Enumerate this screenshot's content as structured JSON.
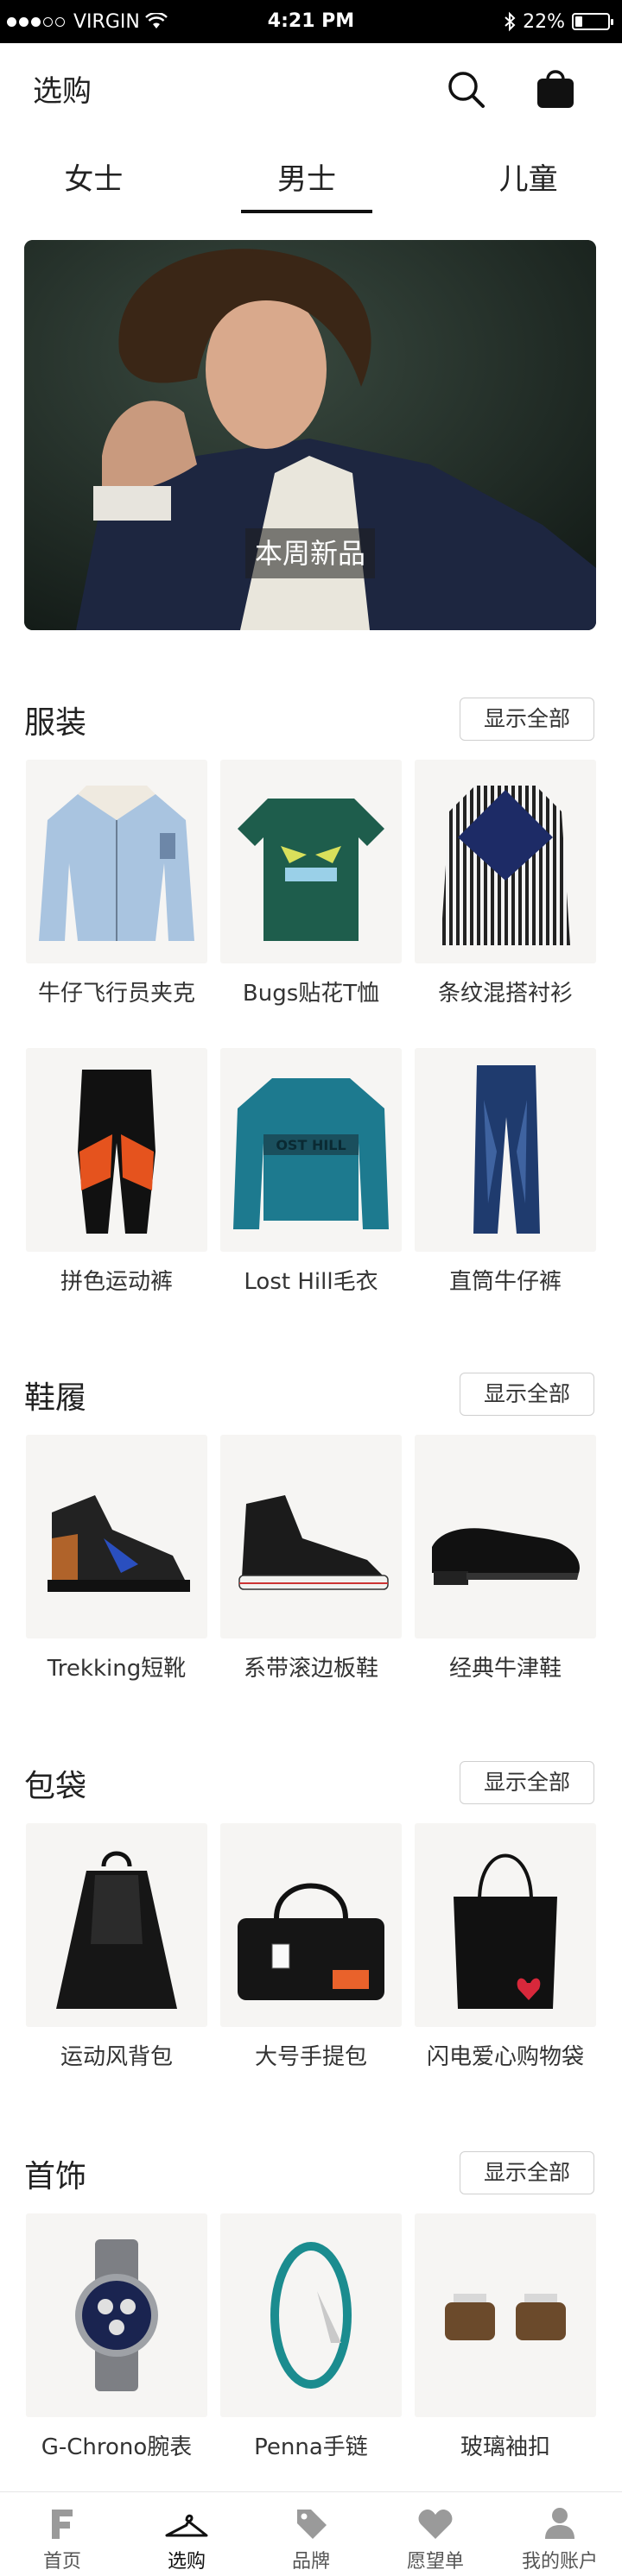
{
  "status_bar": {
    "carrier": "VIRGIN",
    "time": "4:21 PM",
    "battery": "22%",
    "battery_level": 0.22
  },
  "header": {
    "title": "选购",
    "search_icon": "search-icon",
    "bag_icon": "shopping-bag-icon"
  },
  "tabs": [
    {
      "label": "女士",
      "active": false
    },
    {
      "label": "男士",
      "active": true
    },
    {
      "label": "儿童",
      "active": false
    }
  ],
  "hero": {
    "label": "本周新品"
  },
  "sections": [
    {
      "title": "服装",
      "show_all": "显示全部",
      "products": [
        {
          "name": "牛仔飞行员夹克"
        },
        {
          "name": "Bugs贴花T恤"
        },
        {
          "name": "条纹混搭衬衫"
        },
        {
          "name": "拼色运动裤"
        },
        {
          "name": "Lost Hill毛衣"
        },
        {
          "name": "直筒牛仔裤"
        }
      ]
    },
    {
      "title": "鞋履",
      "show_all": "显示全部",
      "products": [
        {
          "name": "Trekking短靴"
        },
        {
          "name": "系带滚边板鞋"
        },
        {
          "name": "经典牛津鞋"
        }
      ]
    },
    {
      "title": "包袋",
      "show_all": "显示全部",
      "products": [
        {
          "name": "运动风背包"
        },
        {
          "name": "大号手提包"
        },
        {
          "name": "闪电爱心购物袋"
        }
      ]
    },
    {
      "title": "首饰",
      "show_all": "显示全部",
      "products": [
        {
          "name": "G-Chrono腕表"
        },
        {
          "name": "Penna手链"
        },
        {
          "name": "玻璃袖扣"
        }
      ]
    }
  ],
  "bottom_nav": [
    {
      "label": "首页",
      "icon": "home-f-icon",
      "active": false
    },
    {
      "label": "选购",
      "icon": "hanger-icon",
      "active": true
    },
    {
      "label": "品牌",
      "icon": "tag-icon",
      "active": false
    },
    {
      "label": "愿望单",
      "icon": "heart-icon",
      "active": false
    },
    {
      "label": "我的账户",
      "icon": "user-icon",
      "active": false
    }
  ],
  "colors": {
    "accent": "#111111",
    "tile_background": "#f6f5f3",
    "nav_inactive": "#9a9a9a"
  }
}
